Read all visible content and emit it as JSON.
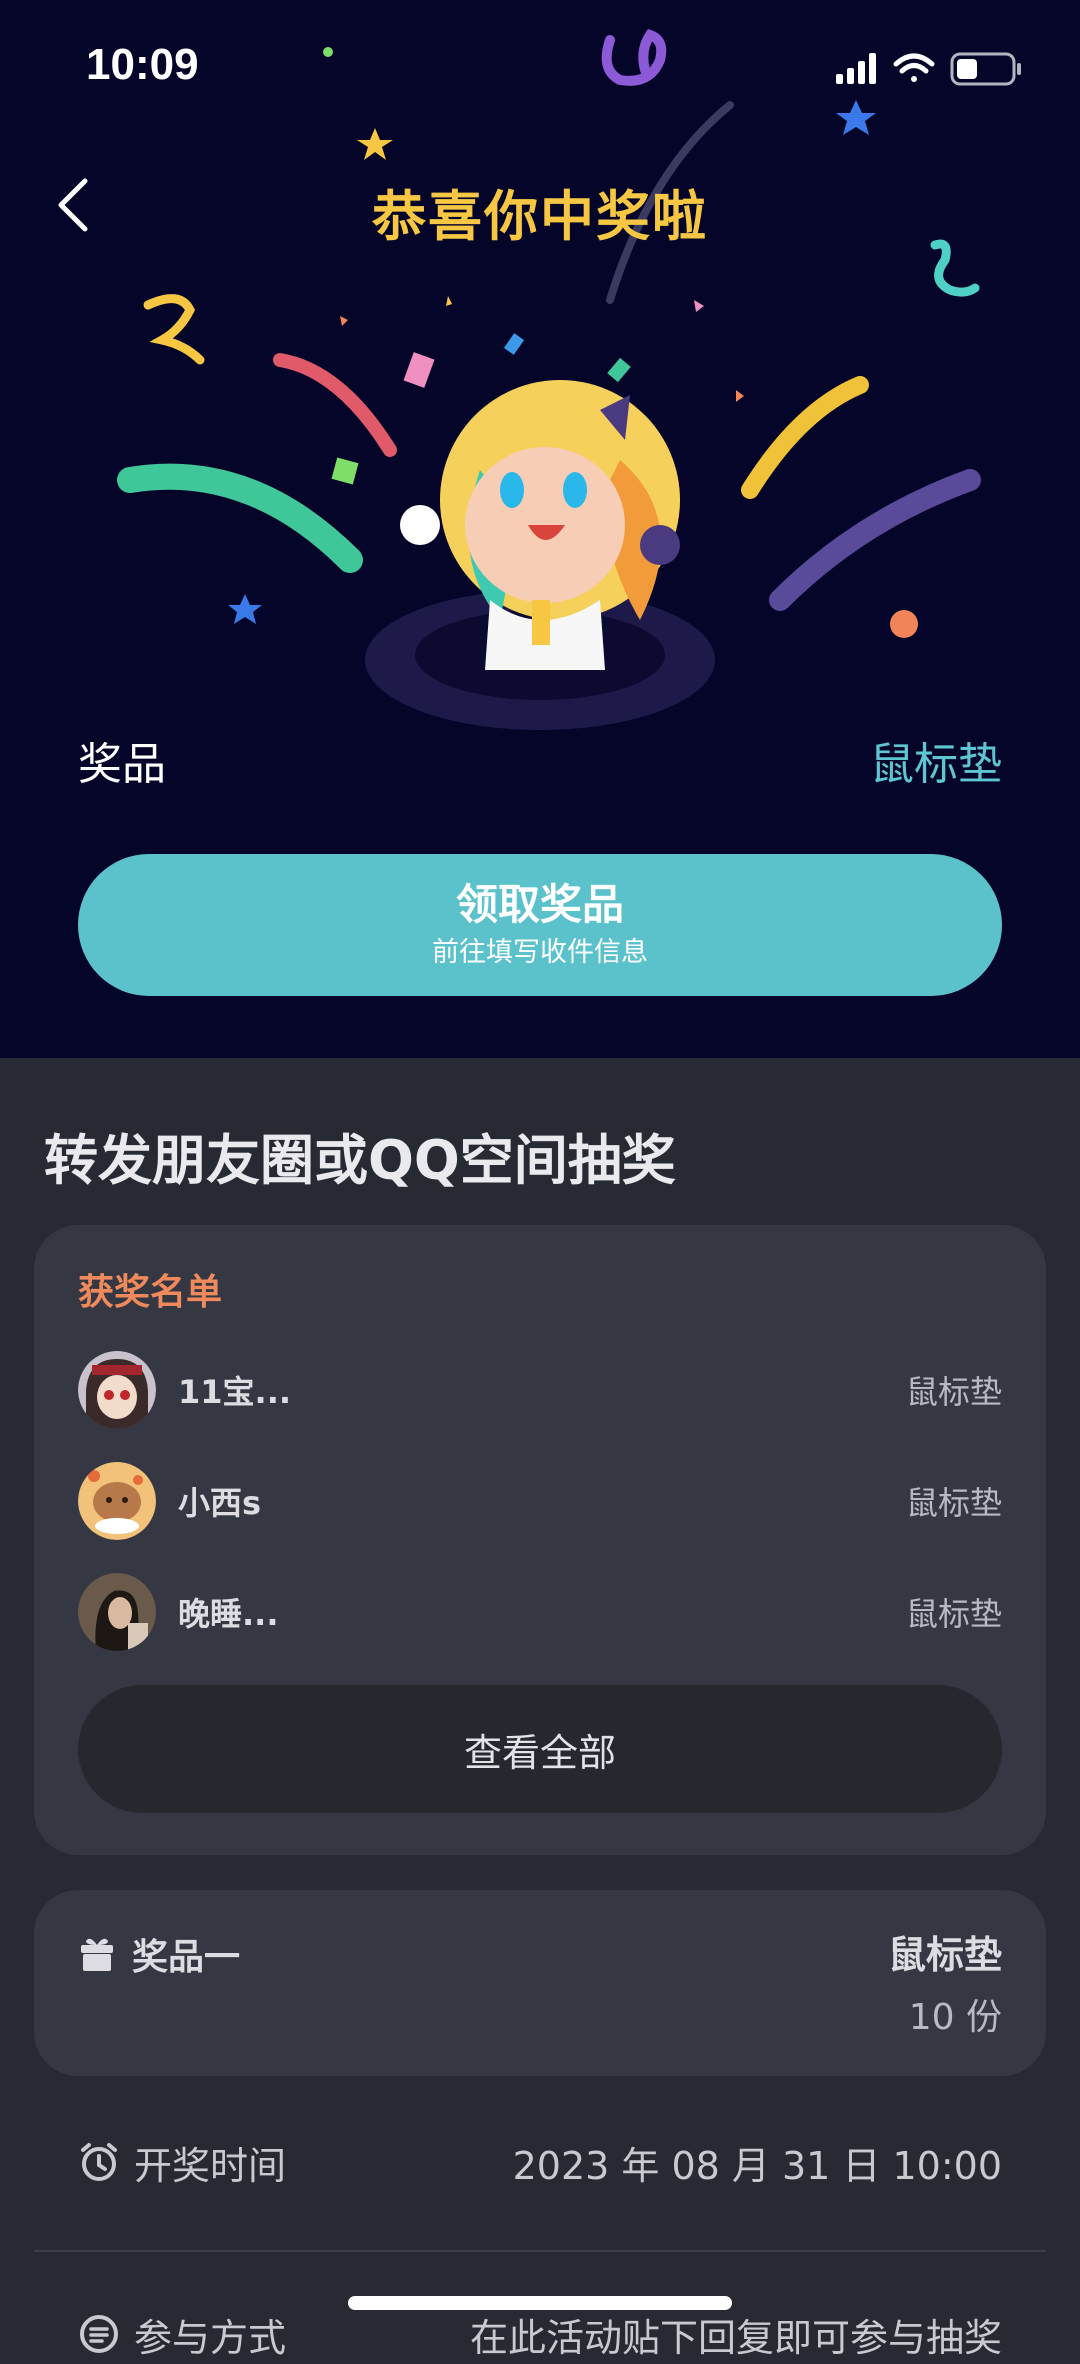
{
  "status_bar": {
    "time": "10:09"
  },
  "header": {
    "title": "恭喜你中奖啦"
  },
  "prize": {
    "label": "奖品",
    "value": "鼠标垫"
  },
  "claim_button": {
    "main": "领取奖品",
    "sub": "前往填写收件信息"
  },
  "section": {
    "title": "转发朋友圈或QQ空间抽奖"
  },
  "winners": {
    "heading": "获奖名单",
    "items": [
      {
        "name": "11宝...",
        "prize": "鼠标垫"
      },
      {
        "name": "小西s",
        "prize": "鼠标垫"
      },
      {
        "name": "晚睡...",
        "prize": "鼠标垫"
      }
    ],
    "view_all": "查看全部"
  },
  "prize_item": {
    "label": "奖品一",
    "name": "鼠标垫",
    "count": "10 份"
  },
  "draw_time": {
    "label": "开奖时间",
    "value": "2023 年 08 月 31 日 10:00"
  },
  "participation": {
    "label": "参与方式",
    "value": "在此活动贴下回复即可参与抽奖"
  },
  "colors": {
    "hero_bg": "#05052a",
    "accent": "#5bc2cc",
    "title_yellow": "#f7c744",
    "winners_heading": "#f08a5d"
  }
}
